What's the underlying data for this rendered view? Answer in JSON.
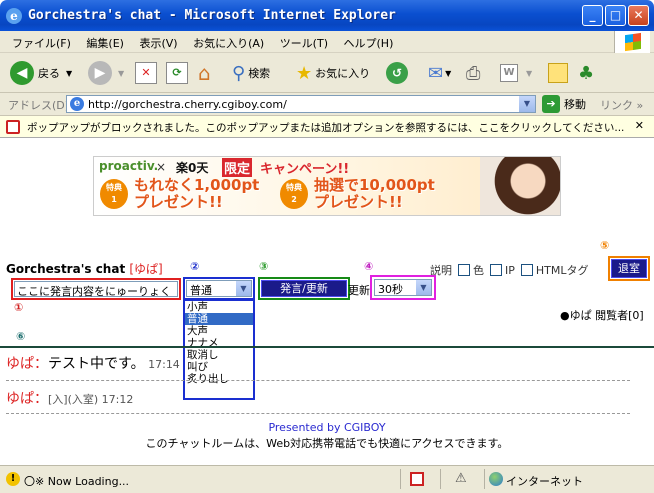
{
  "window": {
    "title": "Gorchestra's chat - Microsoft Internet Explorer",
    "minimize": "_",
    "maximize": "□",
    "close": "✕"
  },
  "menu": [
    "ファイル(F)",
    "編集(E)",
    "表示(V)",
    "お気に入り(A)",
    "ツール(T)",
    "ヘルプ(H)"
  ],
  "toolbar": {
    "back": "戻る",
    "search": "検索",
    "favorites": "お気に入り"
  },
  "address": {
    "label": "アドレス(D)",
    "url": "http://gorchestra.cherry.cgiboy.com/",
    "go": "移動",
    "links": "リンク »"
  },
  "infobar": {
    "message": "ポップアップがブロックされました。このポップアップまたは追加オプションを参照するには、ここをクリックしてください...",
    "close": "✕"
  },
  "banner": {
    "brand": "proactiv.",
    "x": "×",
    "partner": "楽0天",
    "limited": "限定",
    "campaign": "キャンペーン!!",
    "badge1": "特典\n1",
    "offer1": "もれなく1,000pt\nプレゼント!!",
    "badge2": "特典\n2",
    "offer2": "抽選で10,000pt\nプレゼント!!"
  },
  "chat": {
    "title": "Gorchestra's chat",
    "user_tag": "[ゆぱ]",
    "options": {
      "explain": "説明",
      "color": "色",
      "ip": "IP",
      "html_tag": "HTMLタグ"
    },
    "exit_button": "退室",
    "message_value": "ここに発言内容をにゅーりょく",
    "voice_selected": "普通",
    "voice_options": [
      "小声",
      "普通",
      "大声",
      "ナナメ",
      "取消し",
      "叫び",
      "炙り出し"
    ],
    "send_button": "発言/更新",
    "reload_label": "更新",
    "interval_selected": "30秒",
    "viewers": "●ゆぱ 閲覧者[0]",
    "markers": [
      "①",
      "②",
      "③",
      "④",
      "⑤",
      "⑥"
    ],
    "messages": [
      {
        "who": "ゆぱ：",
        "text": "テスト中です。",
        "time": "17:14"
      },
      {
        "who": "ゆぱ：",
        "text": "",
        "time": "[入](入室) 17:12"
      }
    ],
    "credit": "Presented by CGIBOY",
    "note": "このチャットルームは、Web対応携帯電話でも快適にアクセスできます。"
  },
  "status": {
    "text": "〇※ Now Loading...",
    "zone": "インターネット"
  }
}
